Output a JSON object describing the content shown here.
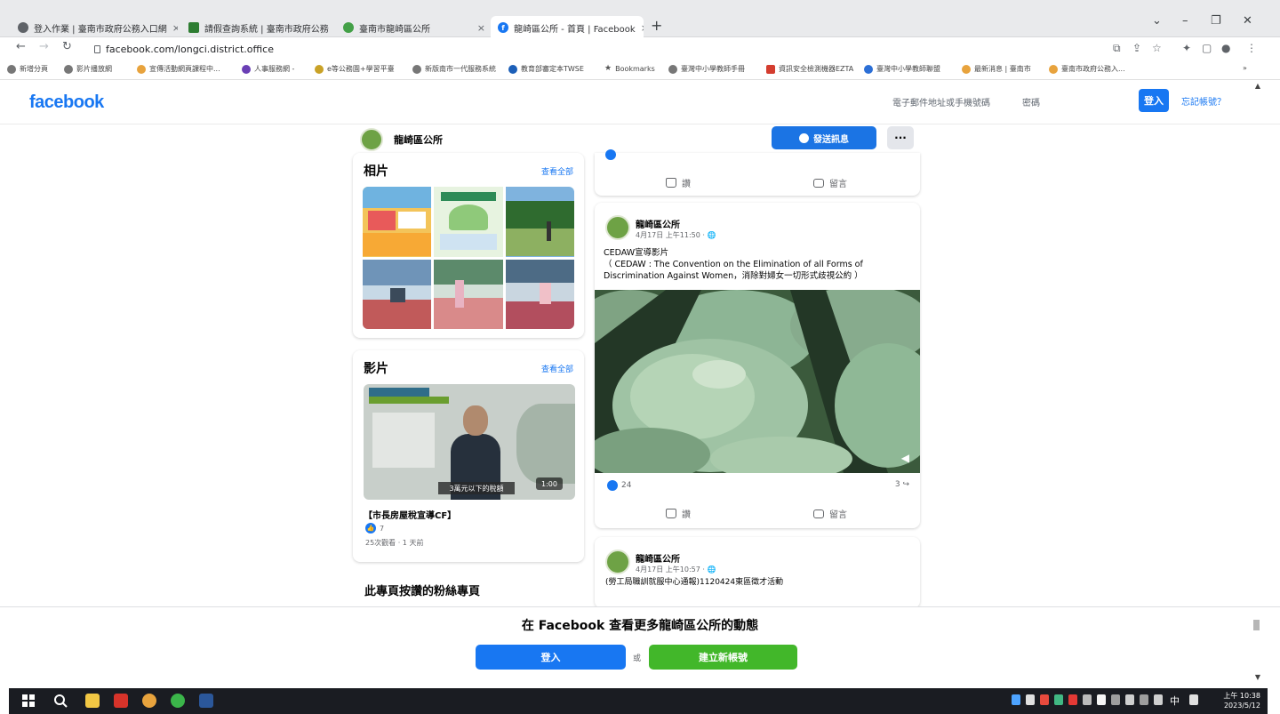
{
  "browser": {
    "tabs": [
      {
        "label": "登入作業 | 臺南市政府公務入口網",
        "color": "#5f6368"
      },
      {
        "label": "請假查詢系統 | 臺南市政府公務",
        "color": "#2e7d32"
      },
      {
        "label": "臺南市龍崎區公所",
        "color": "#43a047"
      },
      {
        "label": "龍崎區公所 - 首頁 | Facebook",
        "color": "#1877f2"
      }
    ],
    "new_tab": "+",
    "url": "facebook.com/longci.district.office",
    "bookmarks": [
      "新增分頁",
      "影片播放網",
      "宣傳活動網頁課程中...",
      "人事服務網 -",
      "e等公務園+學習平臺",
      "新版南市一代服務系統",
      "教育部審定本TWSE",
      "Bookmarks",
      "臺灣中小學教師手冊",
      "資訊安全檢測機器EZTA",
      "臺灣中小學教師聯盟",
      "最新消息 | 臺南市",
      "臺南市政府公務入..."
    ],
    "bookmarks_more": "»"
  },
  "header": {
    "logo": "facebook",
    "email_label": "電子郵件地址或手機號碼",
    "password_label": "密碼",
    "login": "登入",
    "forgot": "忘記帳號？"
  },
  "page": {
    "name": "龍崎區公所",
    "message_button": "發送訊息",
    "more_button": "···"
  },
  "photos": {
    "title": "相片",
    "see_all": "查看全部"
  },
  "videos": {
    "title": "影片",
    "see_all": "查看全部",
    "thumb_caption": "3萬元以下的稅額",
    "thumb_duration": "1:00",
    "video_title": "【市長房屋稅宣導CF】",
    "likes": "7",
    "stats": "25次觀看 · 1 天前"
  },
  "fans": {
    "title": "此專頁按讚的粉絲專頁"
  },
  "post_prev": {
    "like": "讚",
    "comment": "留言"
  },
  "post": {
    "author": "龍崎區公所",
    "time": "4月17日 上午11:50 · 🌐",
    "text_line1": "CEDAW宣導影片",
    "text_line2": "（ CEDAW : The Convention on the Elimination of all Forms of Discrimination Against Women，消除對婦女一切形式歧視公約 ）",
    "reactions": "24",
    "shares": "3",
    "like": "讚",
    "comment": "留言"
  },
  "post3": {
    "author": "龍崎區公所",
    "time": "4月17日 上午10:57 · 🌐",
    "text": "(勞工局職訓就服中心通報)1120424東區徵才活動"
  },
  "banner": {
    "title": "在 Facebook 查看更多龍崎區公所的動態",
    "login": "登入",
    "or": "或",
    "create": "建立新帳號"
  },
  "taskbar": {
    "ime": "中",
    "clock_time": "上午 10:38",
    "clock_date": "2023/5/12"
  },
  "colors": {
    "facebook_blue": "#1877f2",
    "create_green": "#42b72a",
    "taskbar": "#1a1c22"
  }
}
